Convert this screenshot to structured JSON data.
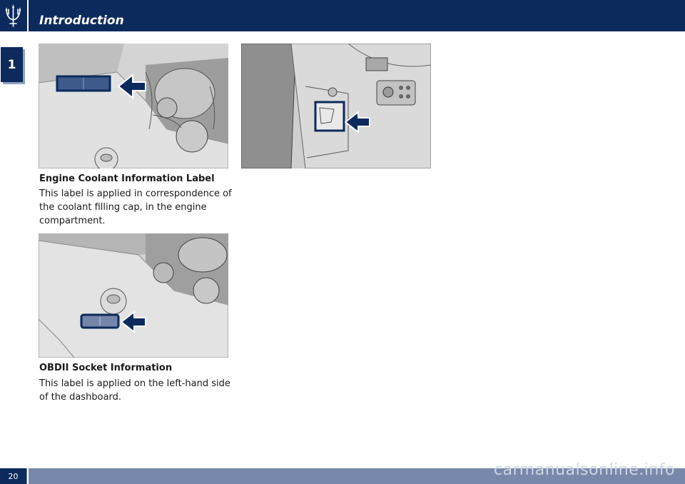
{
  "header": {
    "title": "Introduction",
    "logo": "trident-logo"
  },
  "chapter_tab": "1",
  "section1": {
    "caption": "Engine Coolant Information Label",
    "paragraph": "This label is applied in correspondence of the coolant filling cap, in the engine compartment."
  },
  "section2": {
    "caption": "OBDII Socket Information",
    "paragraph": "This label is applied on the left-hand side of the dashboard."
  },
  "footer": {
    "page_number": "20",
    "watermark": "carmanualsonline.info"
  },
  "colors": {
    "primary": "#0c2a5c",
    "footer_bar": "#7888aa"
  }
}
